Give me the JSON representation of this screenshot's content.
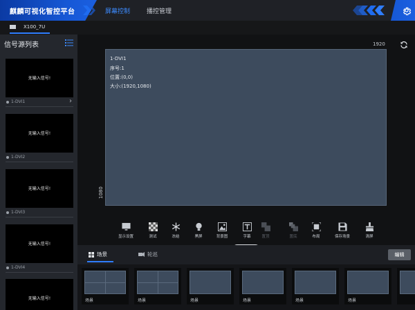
{
  "app": {
    "title": "麒麟可视化智控平台",
    "nav": [
      {
        "label": "屏幕控制",
        "active": true
      },
      {
        "label": "播控管理",
        "active": false
      }
    ],
    "accent_color": "#2f7dff"
  },
  "device_tab": {
    "label": "X100_7U"
  },
  "sidebar": {
    "title": "信号源列表",
    "sources": [
      {
        "label": "1-DVI1",
        "thumb_text": "无输入信号!"
      },
      {
        "label": "1-DVI2",
        "thumb_text": "无输入信号!"
      },
      {
        "label": "1-DVI3",
        "thumb_text": "无输入信号!"
      },
      {
        "label": "1-DVI4",
        "thumb_text": "无输入信号!"
      },
      {
        "label": "",
        "thumb_text": "无输入信号!"
      }
    ]
  },
  "canvas": {
    "width_label": "1920",
    "height_label": "1080",
    "window": {
      "name": "1-DVI1",
      "index": "序号:1",
      "position": "位置:(0,0)",
      "size": "大小:(1920,1080)"
    }
  },
  "toolbar": [
    {
      "label": "显示设置",
      "icon": "monitor-icon",
      "enabled": true
    },
    {
      "label": "测试",
      "icon": "test-pattern-icon",
      "enabled": true
    },
    {
      "label": "冻结",
      "icon": "snowflake-icon",
      "enabled": true
    },
    {
      "label": "黑屏",
      "icon": "bulb-icon",
      "enabled": true
    },
    {
      "label": "背景图",
      "icon": "image-icon",
      "enabled": true
    },
    {
      "label": "字幕",
      "icon": "subtitle-icon",
      "enabled": true
    },
    {
      "label": "置顶",
      "icon": "bring-front-icon",
      "enabled": false
    },
    {
      "label": "置底",
      "icon": "send-back-icon",
      "enabled": false
    },
    {
      "label": "布局",
      "icon": "layout-icon",
      "enabled": true
    },
    {
      "label": "保存场景",
      "icon": "save-icon",
      "enabled": true
    },
    {
      "label": "清屏",
      "icon": "clear-icon",
      "enabled": true
    }
  ],
  "bottom_panel": {
    "tabs": [
      {
        "label": "场景",
        "icon": "scene-grid-icon",
        "active": true
      },
      {
        "label": "轮巡",
        "icon": "tour-icon",
        "active": false
      }
    ],
    "edit_label": "编辑",
    "scenes": [
      {
        "label": "场景",
        "split": true
      },
      {
        "label": "场景",
        "split": true
      },
      {
        "label": "场景",
        "split": false
      },
      {
        "label": "场景",
        "split": false
      },
      {
        "label": "场景",
        "split": false
      },
      {
        "label": "场景",
        "split": false
      },
      {
        "label": "",
        "split": false
      }
    ]
  }
}
